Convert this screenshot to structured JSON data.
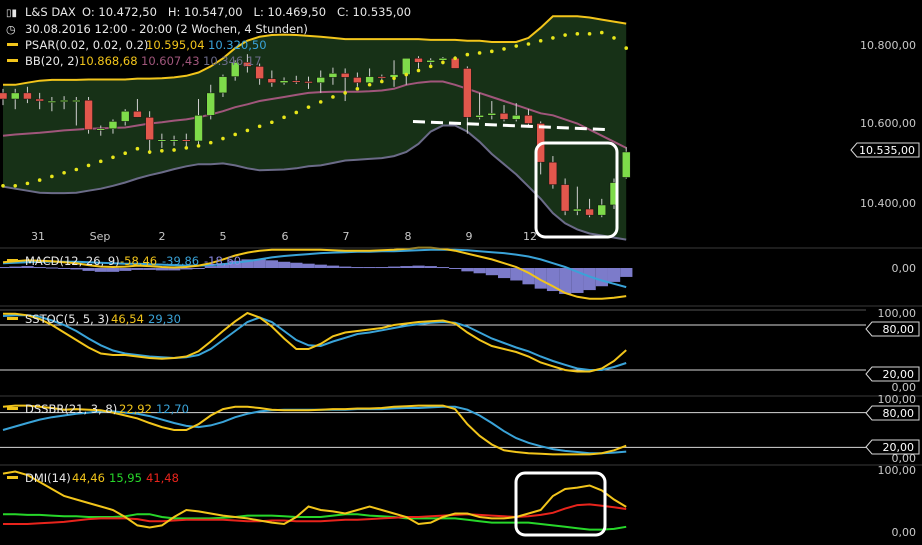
{
  "header": {
    "symbol": "L&S DAX",
    "ohlc": "O: 10.472,50   H: 10.547,00   L: 10.469,50   C: 10.535,00",
    "period": "30.08.2016 12:00 - 20:00 (2 Wochen, 4 Stunden)",
    "psar_label": "PSAR(0.02, 0.02, 0.2)",
    "psar_v1": "10.595,04",
    "psar_v2": "10.320,50",
    "bb_label": "BB(20, 2)",
    "bb_v1": "10.868,68",
    "bb_v2": "10.607,43",
    "bb_v3": "10.346,17"
  },
  "colors": {
    "background": "#000000",
    "bb_fill": "#173117",
    "bb_upper": "#f2c51b",
    "bb_mid": "#a0567b",
    "bb_lower": "#6b6b88",
    "psar": "#e7e51a",
    "candle_up": "#7edb4a",
    "candle_down": "#e2574c",
    "label_text": "#c8c8c8",
    "yellow_line": "#f2c51b",
    "blue_line": "#3aa3d8",
    "macd_hist": "#8a88e0",
    "dmi_green": "#27d72a",
    "dmi_red": "#e8241c",
    "callout": "#ffffff"
  },
  "x_labels": [
    "31",
    "Sep",
    "2",
    "5",
    "6",
    "7",
    "8",
    "9",
    "12"
  ],
  "price_axis": {
    "labels": [
      "10.800,00",
      "10.600,00",
      "10.400,00"
    ],
    "current": "10.535,00"
  },
  "panels": {
    "macd": {
      "label": "MACD(12, 26, 9)",
      "v1": "-58,46",
      "v2": "-39,86",
      "v3": "-18,60",
      "axis": "0,00"
    },
    "sstoc": {
      "label": "SSTOC(5, 5, 3)",
      "v1": "46,54",
      "v2": "29,30",
      "axis_top": "100,00",
      "hi": "80,00",
      "lo": "20,00",
      "axis_bottom": "0,00"
    },
    "dssbr": {
      "label": "DSSBR(21, 3, 8)",
      "v1": "22,92",
      "v2": "12,70",
      "axis_top": "100,00",
      "hi": "80,00",
      "lo": "20,00",
      "axis_bottom": "0,00"
    },
    "dmi": {
      "label": "DMI(14)",
      "v1": "44,46",
      "v2": "15,95",
      "v3": "41,48",
      "axis_top": "100,00",
      "axis_bottom": "0,00"
    }
  },
  "chart_data": [
    {
      "type": "candlestick",
      "title": "L&S DAX",
      "ylim": [
        10300,
        10870
      ],
      "candles": [
        [
          10680,
          10690,
          10650,
          10665
        ],
        [
          10665,
          10690,
          10640,
          10680
        ],
        [
          10680,
          10695,
          10655,
          10665
        ],
        [
          10665,
          10680,
          10640,
          10660
        ],
        [
          10660,
          10670,
          10635,
          10660
        ],
        [
          10660,
          10672,
          10640,
          10662
        ],
        [
          10662,
          10670,
          10600,
          10662
        ],
        [
          10662,
          10670,
          10580,
          10590
        ],
        [
          10590,
          10600,
          10575,
          10592
        ],
        [
          10592,
          10615,
          10580,
          10610
        ],
        [
          10610,
          10640,
          10600,
          10635
        ],
        [
          10635,
          10665,
          10620,
          10620
        ],
        [
          10620,
          10635,
          10530,
          10565
        ],
        [
          10565,
          10580,
          10545,
          10565
        ],
        [
          10565,
          10575,
          10550,
          10565
        ],
        [
          10565,
          10580,
          10545,
          10562
        ],
        [
          10562,
          10665,
          10550,
          10625
        ],
        [
          10625,
          10700,
          10615,
          10680
        ],
        [
          10680,
          10725,
          10670,
          10720
        ],
        [
          10720,
          10760,
          10710,
          10755
        ],
        [
          10755,
          10775,
          10730,
          10745
        ],
        [
          10745,
          10752,
          10700,
          10715
        ],
        [
          10715,
          10735,
          10695,
          10705
        ],
        [
          10705,
          10718,
          10700,
          10710
        ],
        [
          10710,
          10722,
          10702,
          10708
        ],
        [
          10708,
          10720,
          10690,
          10705
        ],
        [
          10705,
          10735,
          10680,
          10718
        ],
        [
          10718,
          10742,
          10700,
          10728
        ],
        [
          10728,
          10740,
          10660,
          10718
        ],
        [
          10718,
          10730,
          10695,
          10705
        ],
        [
          10705,
          10740,
          10700,
          10720
        ],
        [
          10720,
          10725,
          10708,
          10718
        ],
        [
          10718,
          10760,
          10695,
          10725
        ],
        [
          10725,
          10760,
          10700,
          10765
        ],
        [
          10765,
          10770,
          10740,
          10755
        ],
        [
          10755,
          10765,
          10745,
          10760
        ],
        [
          10760,
          10768,
          10750,
          10765
        ],
        [
          10765,
          10770,
          10745,
          10740
        ],
        [
          10740,
          10745,
          10580,
          10620
        ],
        [
          10620,
          10680,
          10615,
          10625
        ],
        [
          10625,
          10660,
          10615,
          10630
        ],
        [
          10630,
          10650,
          10610,
          10615
        ],
        [
          10615,
          10655,
          10610,
          10625
        ],
        [
          10625,
          10640,
          10595,
          10605
        ],
        [
          10605,
          10610,
          10480,
          10510
        ],
        [
          10510,
          10525,
          10445,
          10455
        ],
        [
          10455,
          10470,
          10380,
          10390
        ],
        [
          10390,
          10450,
          10380,
          10395
        ],
        [
          10395,
          10420,
          10375,
          10380
        ],
        [
          10380,
          10420,
          10375,
          10405
        ],
        [
          10405,
          10470,
          10395,
          10460
        ],
        [
          10472.5,
          10547,
          10469.5,
          10535
        ]
      ],
      "bb_upper": [
        10700,
        10700,
        10705,
        10710,
        10712,
        10712,
        10712,
        10713,
        10713,
        10713,
        10713,
        10715,
        10715,
        10716,
        10718,
        10722,
        10730,
        10745,
        10765,
        10790,
        10808,
        10818,
        10822,
        10823,
        10822,
        10820,
        10818,
        10815,
        10812,
        10812,
        10812,
        10812,
        10812,
        10812,
        10812,
        10810,
        10810,
        10810,
        10808,
        10808,
        10805,
        10805,
        10805,
        10815,
        10840,
        10868,
        10868,
        10868,
        10865,
        10860,
        10855,
        10850
      ],
      "bb_mid": [
        10575,
        10578,
        10580,
        10582,
        10585,
        10588,
        10590,
        10592,
        10593,
        10594,
        10595,
        10600,
        10605,
        10608,
        10612,
        10615,
        10620,
        10627,
        10635,
        10645,
        10652,
        10660,
        10665,
        10670,
        10675,
        10680,
        10682,
        10683,
        10683,
        10683,
        10684,
        10686,
        10690,
        10700,
        10705,
        10708,
        10708,
        10700,
        10690,
        10680,
        10670,
        10660,
        10650,
        10640,
        10630,
        10625,
        10615,
        10605,
        10590,
        10575,
        10560,
        10545
      ],
      "bb_lower": [
        10450,
        10445,
        10440,
        10435,
        10434,
        10434,
        10435,
        10440,
        10445,
        10452,
        10460,
        10470,
        10478,
        10485,
        10493,
        10500,
        10505,
        10505,
        10507,
        10502,
        10495,
        10490,
        10491,
        10492,
        10495,
        10500,
        10502,
        10508,
        10514,
        10516,
        10518,
        10520,
        10525,
        10535,
        10555,
        10585,
        10600,
        10600,
        10585,
        10560,
        10530,
        10505,
        10480,
        10450,
        10420,
        10385,
        10360,
        10345,
        10335,
        10330,
        10325,
        10320
      ],
      "psar": [
        10452,
        10452,
        10458,
        10466,
        10475,
        10484,
        10492,
        10502,
        10512,
        10522,
        10532,
        10543,
        10535,
        10538,
        10540,
        10545,
        10550,
        10558,
        10568,
        10578,
        10588,
        10598,
        10608,
        10620,
        10632,
        10645,
        10658,
        10670,
        10680,
        10690,
        10700,
        10708,
        10716,
        10725,
        10735,
        10745,
        10755,
        10765,
        10774,
        10778,
        10782,
        10788,
        10795,
        10800,
        10808,
        10815,
        10822,
        10825,
        10825,
        10828,
        10815,
        10790
      ],
      "resistance_level": 10595,
      "current_price": 10535
    },
    {
      "type": "bar_line",
      "title": "MACD(12, 26, 9)",
      "macd": [
        12,
        14,
        16,
        15,
        14,
        12,
        10,
        6,
        3,
        2,
        3,
        5,
        4,
        2,
        1,
        2,
        5,
        10,
        18,
        26,
        32,
        36,
        38,
        38,
        38,
        38,
        38,
        37,
        36,
        36,
        36,
        37,
        38,
        40,
        42,
        42,
        40,
        36,
        30,
        24,
        18,
        10,
        2,
        -10,
        -25,
        -38,
        -52,
        -60,
        -64,
        -64,
        -62,
        -58.46
      ],
      "signal": [
        10,
        11,
        12,
        13,
        13,
        13,
        13,
        12,
        11,
        10,
        9,
        9,
        8,
        7,
        6,
        5,
        5,
        6,
        8,
        11,
        14,
        18,
        22,
        25,
        27,
        29,
        31,
        32,
        33,
        34,
        34,
        35,
        35,
        36,
        37,
        38,
        38,
        38,
        37,
        35,
        33,
        31,
        28,
        24,
        18,
        10,
        2,
        -8,
        -18,
        -26,
        -33,
        -39.86
      ],
      "histogram": [
        2,
        3,
        4,
        2,
        1,
        -1,
        -3,
        -6,
        -8,
        -8,
        -6,
        -4,
        -4,
        -5,
        -5,
        -3,
        0,
        4,
        10,
        15,
        18,
        18,
        16,
        13,
        11,
        9,
        7,
        5,
        3,
        2,
        2,
        2,
        3,
        4,
        5,
        4,
        2,
        -2,
        -7,
        -11,
        -15,
        -21,
        -26,
        -34,
        -43,
        -48,
        -54,
        -52,
        -46,
        -38,
        -29,
        -18.6
      ]
    },
    {
      "type": "line",
      "title": "SSTOC(5, 5, 3)",
      "ylim": [
        0,
        100
      ],
      "k": [
        95,
        95,
        93,
        88,
        80,
        70,
        60,
        50,
        42,
        40,
        40,
        38,
        36,
        35,
        36,
        38,
        45,
        58,
        72,
        85,
        96,
        90,
        78,
        62,
        48,
        48,
        55,
        65,
        70,
        72,
        74,
        76,
        80,
        82,
        84,
        85,
        86,
        82,
        70,
        60,
        52,
        48,
        44,
        38,
        30,
        25,
        20,
        18,
        18,
        22,
        32,
        46.54
      ],
      "d": [
        92,
        93,
        93,
        91,
        86,
        80,
        72,
        62,
        53,
        46,
        42,
        40,
        38,
        37,
        36,
        37,
        40,
        48,
        60,
        72,
        84,
        90,
        84,
        72,
        60,
        53,
        52,
        58,
        63,
        68,
        70,
        73,
        76,
        79,
        81,
        83,
        84,
        83,
        78,
        70,
        62,
        56,
        50,
        45,
        38,
        32,
        27,
        22,
        20,
        20,
        24,
        29.3
      ]
    },
    {
      "type": "line",
      "title": "DSSBR(21, 3, 8)",
      "ylim": [
        0,
        100
      ],
      "k": [
        90,
        92,
        92,
        90,
        88,
        85,
        86,
        85,
        84,
        80,
        75,
        70,
        62,
        55,
        50,
        50,
        60,
        75,
        86,
        90,
        90,
        88,
        85,
        84,
        84,
        84,
        85,
        86,
        86,
        87,
        87,
        88,
        90,
        91,
        92,
        92,
        92,
        86,
        60,
        40,
        25,
        15,
        12,
        10,
        9,
        8,
        8,
        8,
        8,
        10,
        15,
        22.92
      ],
      "d": [
        50,
        56,
        62,
        68,
        72,
        75,
        78,
        80,
        82,
        82,
        80,
        78,
        74,
        68,
        62,
        57,
        55,
        58,
        64,
        72,
        78,
        82,
        84,
        85,
        85,
        85,
        85,
        85,
        85,
        86,
        86,
        86,
        87,
        88,
        88,
        89,
        90,
        90,
        85,
        75,
        62,
        48,
        36,
        28,
        22,
        17,
        14,
        12,
        10,
        10,
        11,
        12.7
      ]
    },
    {
      "type": "line",
      "title": "DMI(14)",
      "ylim": [
        0,
        100
      ],
      "adx": [
        92,
        95,
        90,
        80,
        70,
        60,
        55,
        50,
        45,
        40,
        30,
        18,
        15,
        18,
        30,
        40,
        38,
        35,
        32,
        30,
        28,
        25,
        22,
        20,
        30,
        45,
        40,
        38,
        35,
        40,
        45,
        40,
        35,
        30,
        20,
        22,
        30,
        35,
        35,
        30,
        28,
        28,
        30,
        35,
        40,
        60,
        70,
        72,
        75,
        68,
        55,
        44.46
      ],
      "plus_di": [
        34,
        34,
        33,
        33,
        32,
        31,
        31,
        30,
        30,
        30,
        31,
        34,
        34,
        30,
        28,
        28,
        28,
        28,
        29,
        30,
        32,
        32,
        32,
        31,
        30,
        30,
        30,
        32,
        34,
        34,
        32,
        31,
        30,
        28,
        28,
        28,
        28,
        28,
        26,
        24,
        22,
        22,
        22,
        22,
        20,
        18,
        16,
        14,
        12,
        12,
        13,
        15.95
      ],
      "minus_di": [
        20,
        20,
        20,
        21,
        22,
        23,
        25,
        27,
        28,
        28,
        28,
        27,
        24,
        24,
        25,
        26,
        26,
        26,
        26,
        25,
        24,
        24,
        25,
        25,
        24,
        24,
        24,
        25,
        26,
        26,
        27,
        28,
        29,
        30,
        30,
        31,
        32,
        33,
        34,
        33,
        32,
        31,
        30,
        31,
        33,
        36,
        42,
        47,
        48,
        46,
        44,
        41.48
      ]
    }
  ]
}
